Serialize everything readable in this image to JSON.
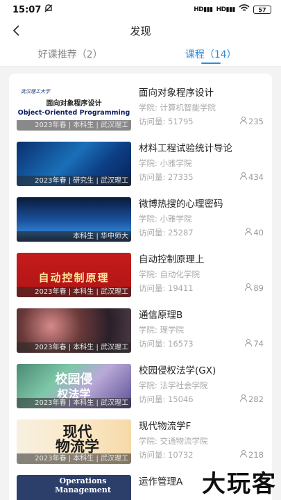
{
  "status_bar": {
    "time": "15:07",
    "signal1": "HD",
    "signal2": "HD",
    "battery": "57"
  },
  "nav": {
    "title": "发现"
  },
  "tabs": [
    {
      "label": "好课推荐（2）",
      "active": false
    },
    {
      "label": "课程（14）",
      "active": true
    }
  ],
  "labels": {
    "school_prefix": "学院:",
    "visits_prefix": "访问量:"
  },
  "courses": [
    {
      "title": "面向对象程序设计",
      "school": "计算机智能学院",
      "visits": "51795",
      "students": "235",
      "caption": "2023年春 | 本科生 | 武汉理工",
      "cover_line1": "面向对象程序设计",
      "cover_line2": "Object-Oriented Programming",
      "cover_logo": "武汉理工大学"
    },
    {
      "title": "材料工程试验统计导论",
      "school": "小雅学院",
      "visits": "27335",
      "students": "434",
      "caption": "2023年春 | 研究生 | 武汉理工"
    },
    {
      "title": "微博热搜的心理密码",
      "school": "小雅学院",
      "visits": "25287",
      "students": "40",
      "caption": "本科生 | 华中师大"
    },
    {
      "title": "自动控制原理上",
      "school": "自动化学院",
      "visits": "19411",
      "students": "89",
      "caption": "2023年春 | 本科生 | 武汉理工",
      "cover_line1": "自动控制原理"
    },
    {
      "title": "通信原理B",
      "school": "理学院",
      "visits": "16573",
      "students": "74",
      "caption": "2023年春 | 本科生 | 武汉理工"
    },
    {
      "title": "校园侵权法学(GX)",
      "school": "法学社会学院",
      "visits": "15046",
      "students": "282",
      "caption": "2023年春 | 本科生 | 武汉理工",
      "cover_line1": "校园侵",
      "cover_line2": "权法学"
    },
    {
      "title": "现代物流学F",
      "school": "交通物流学院",
      "visits": "10732",
      "students": "218",
      "caption": "2023年春 | 本科生 | 武汉理工",
      "cover_line1": "现代",
      "cover_line2": "物流学"
    },
    {
      "title": "运作管理A",
      "cover_line1": "Operations",
      "cover_line2": "Management"
    }
  ],
  "watermark": "大玩客"
}
